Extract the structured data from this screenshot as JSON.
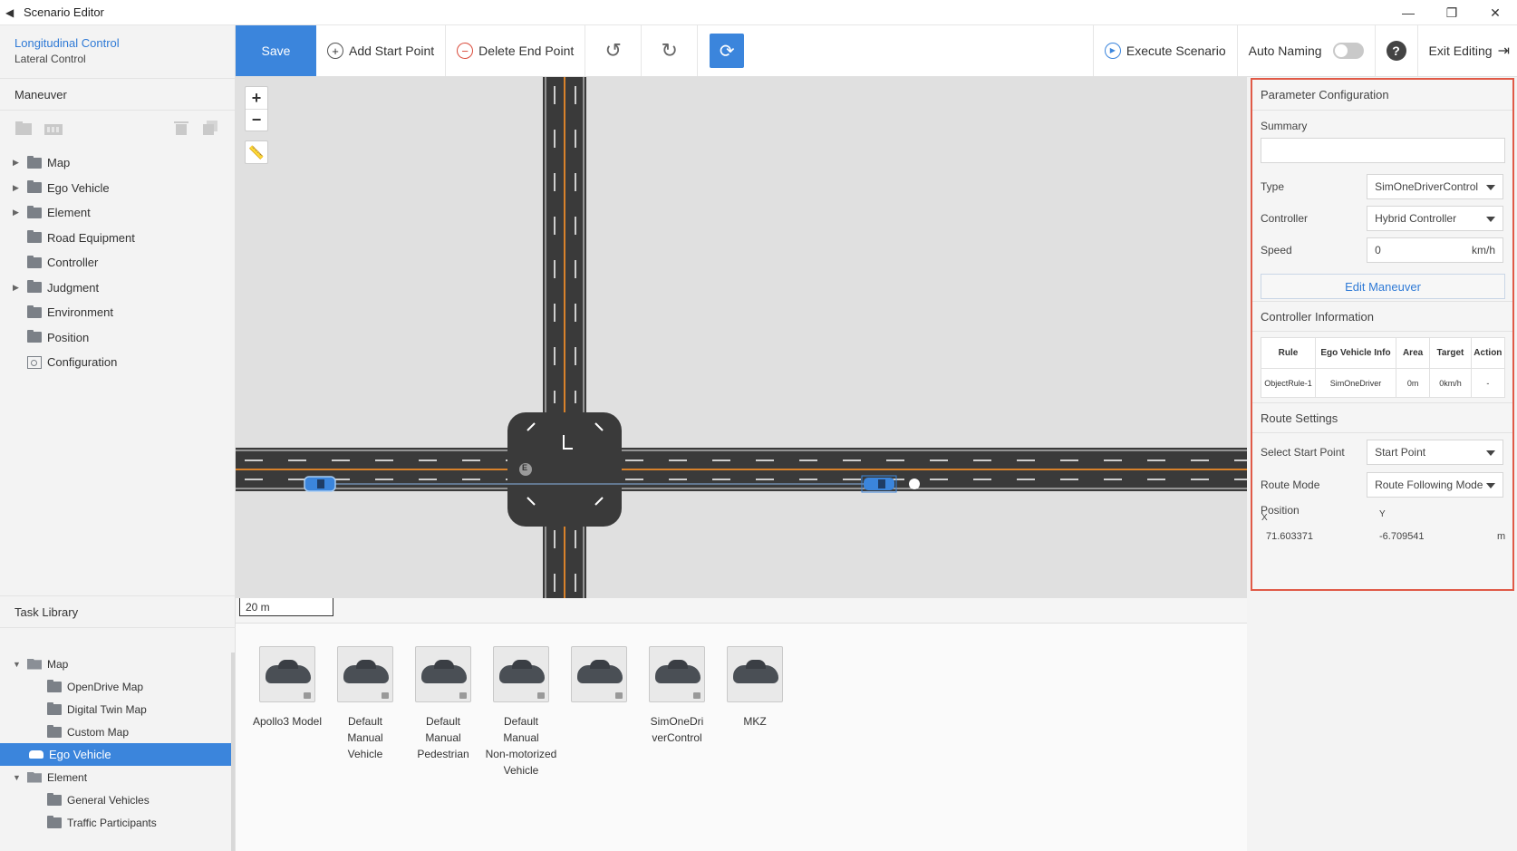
{
  "window": {
    "title": "Scenario Editor",
    "controls": {
      "minimize": "—",
      "restore": "❐",
      "close": "✕"
    }
  },
  "mode": {
    "active": "Longitudinal Control",
    "inactive": "Lateral Control"
  },
  "maneuver": {
    "title": "Maneuver",
    "tree": [
      {
        "label": "Map",
        "expandable": true
      },
      {
        "label": "Ego Vehicle",
        "expandable": true
      },
      {
        "label": "Element",
        "expandable": true
      },
      {
        "label": "Road Equipment",
        "expandable": false
      },
      {
        "label": "Controller",
        "expandable": false
      },
      {
        "label": "Judgment",
        "expandable": true
      },
      {
        "label": "Environment",
        "expandable": false
      },
      {
        "label": "Position",
        "expandable": false
      },
      {
        "label": "Configuration",
        "expandable": false
      }
    ]
  },
  "task_library": {
    "title": "Task Library",
    "items": [
      {
        "label": "Map",
        "level": 0,
        "expanded": true
      },
      {
        "label": "OpenDrive Map",
        "level": 1
      },
      {
        "label": "Digital Twin Map",
        "level": 1
      },
      {
        "label": "Custom Map",
        "level": 1
      },
      {
        "label": "Ego Vehicle",
        "level": 0,
        "selected": true
      },
      {
        "label": "Element",
        "level": 0,
        "expanded": true
      },
      {
        "label": "General Vehicles",
        "level": 1
      },
      {
        "label": "Traffic Participants",
        "level": 1
      }
    ]
  },
  "toolbar": {
    "save": "Save",
    "add_start": "Add Start Point",
    "delete_end": "Delete End Point",
    "undo_icon": "↺",
    "redo_icon": "↻",
    "refresh_icon": "⟳",
    "execute": "Execute Scenario",
    "auto_naming": "Auto Naming",
    "auto_naming_on": false,
    "help": "?",
    "exit": "Exit Editing",
    "exit_icon": "⇥"
  },
  "map": {
    "zoom_in": "+",
    "zoom_out": "−",
    "scale": "20 m",
    "marker": "E"
  },
  "library_cards": [
    {
      "lines": [
        "Apollo3 Model"
      ],
      "locked": true
    },
    {
      "lines": [
        "Default",
        "Manual",
        "Vehicle"
      ],
      "locked": true
    },
    {
      "lines": [
        "Default",
        "Manual",
        "Pedestrian"
      ],
      "locked": true
    },
    {
      "lines": [
        "Default",
        "Manual",
        "Non-motorized",
        "Vehicle"
      ],
      "locked": true
    },
    {
      "lines": [
        ""
      ],
      "locked": true
    },
    {
      "lines": [
        "SimOneDri",
        "verControl"
      ],
      "locked": true
    },
    {
      "lines": [
        "MKZ"
      ],
      "locked": false
    }
  ],
  "params": {
    "title": "Parameter Configuration",
    "summary_label": "Summary",
    "summary_value": "",
    "type_label": "Type",
    "type_value": "SimOneDriverControl",
    "controller_label": "Controller",
    "controller_value": "Hybrid Controller",
    "speed_label": "Speed",
    "speed_value": "0",
    "speed_unit": "km/h",
    "edit_button": "Edit Maneuver",
    "controller_info_title": "Controller Information",
    "table": {
      "headers": [
        "Rule",
        "Ego Vehicle Info",
        "Area",
        "Target",
        "Action"
      ],
      "rows": [
        [
          "ObjectRule-1",
          "SimOneDriver",
          "0m",
          "0km/h",
          "-"
        ]
      ]
    },
    "route_title": "Route Settings",
    "start_label": "Select Start Point",
    "start_value": "Start Point",
    "route_mode_label": "Route Mode",
    "route_mode_value": "Route Following Mode",
    "position_label": "Position",
    "x_label": "X",
    "y_label": "Y",
    "x_value": "71.603371",
    "y_value": "-6.709541",
    "unit": "m"
  },
  "colors": {
    "accent": "#3b85dc",
    "highlight_border": "#e05a47",
    "road": "#3a3a3a",
    "lane_center": "#d9822b"
  }
}
